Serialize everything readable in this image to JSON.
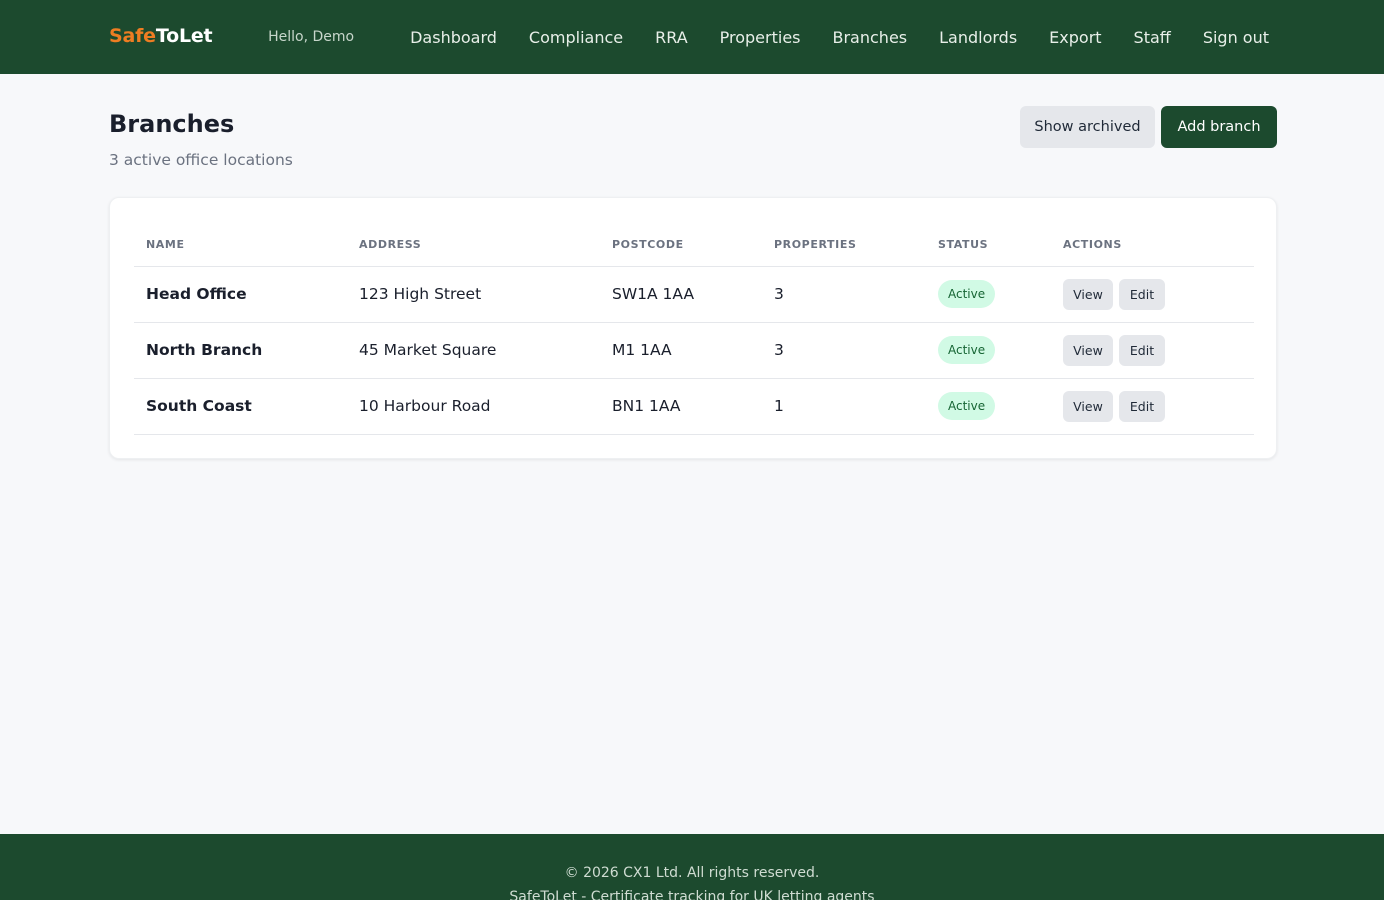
{
  "brand": {
    "part1": "Safe",
    "part2": "ToLet",
    "accent_color": "#ee7d22",
    "primary_color": "#1c4a2e"
  },
  "nav": {
    "greeting": "Hello, Demo",
    "links": [
      "Dashboard",
      "Compliance",
      "RRA",
      "Properties",
      "Branches",
      "Landlords",
      "Export",
      "Staff",
      "Sign out"
    ]
  },
  "page": {
    "title": "Branches",
    "subtitle": "3 active office locations",
    "show_archived_label": "Show archived",
    "add_label": "Add branch"
  },
  "table": {
    "headers": [
      "NAME",
      "ADDRESS",
      "POSTCODE",
      "PROPERTIES",
      "STATUS",
      "ACTIONS"
    ],
    "rows": [
      {
        "name": "Head Office",
        "address": "123 High Street",
        "postcode": "SW1A 1AA",
        "properties": "3",
        "status": "Active",
        "view": "View",
        "edit": "Edit"
      },
      {
        "name": "North Branch",
        "address": "45 Market Square",
        "postcode": "M1 1AA",
        "properties": "3",
        "status": "Active",
        "view": "View",
        "edit": "Edit"
      },
      {
        "name": "South Coast",
        "address": "10 Harbour Road",
        "postcode": "BN1 1AA",
        "properties": "1",
        "status": "Active",
        "view": "View",
        "edit": "Edit"
      }
    ]
  },
  "footer": {
    "copyright": "© 2026 CX1 Ltd. All rights reserved.",
    "tagline": "SafeToLet - Certificate tracking for UK letting agents"
  }
}
